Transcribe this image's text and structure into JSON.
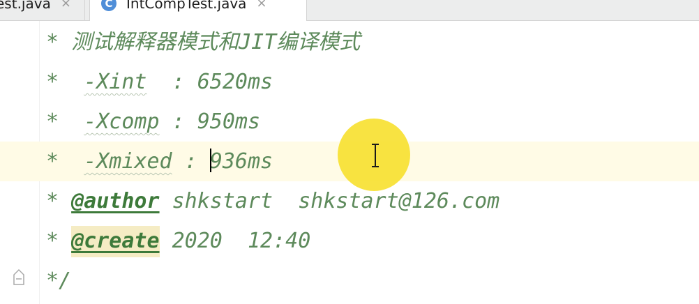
{
  "tabs": [
    {
      "label": "est.java",
      "close": "×",
      "active": false
    },
    {
      "label": "IntCompTest.java",
      "close": "×",
      "active": true,
      "icon": "C"
    }
  ],
  "lines": [
    {
      "star": "*",
      "text": " 测试解释器模式和JIT编译模式"
    },
    {
      "star": "*",
      "flag": "-Xint",
      "sep": "  : ",
      "value": "6520ms"
    },
    {
      "star": "*",
      "flag": "-Xcomp",
      "sep": " : ",
      "value": "950ms"
    },
    {
      "star": "*",
      "flag": "-Xmixed",
      "sep": " : ",
      "value": "936ms"
    },
    {
      "star": "*",
      "tag": "@author",
      "rest": " shkstart  shkstart@126.com"
    },
    {
      "star": "*",
      "tag": "@create",
      "rest": " 2020  12:40"
    },
    {
      "end": "*/"
    }
  ],
  "colors": {
    "comment": "#5d8a5b",
    "tag": "#3d7a3a",
    "current_line": "#fffbe6",
    "cursor_highlight": "#f7e132",
    "tab_bar": "#eceded",
    "class_icon": "#4f8ed8"
  },
  "icons": {
    "class": "class-file-icon",
    "fold": "fold-collapse-icon",
    "close": "close-icon",
    "pointer": "ibeam-cursor-icon"
  }
}
